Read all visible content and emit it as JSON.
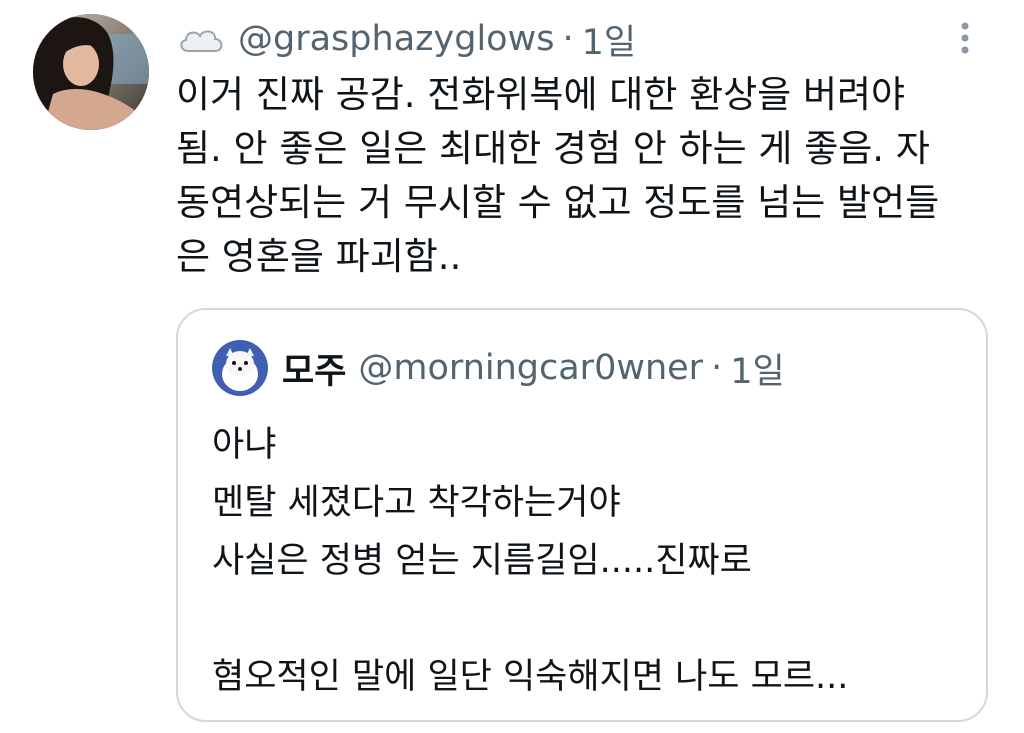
{
  "tweet": {
    "handle": "@grasphazyglows",
    "separator": "·",
    "time": "1일",
    "text": "이거 진짜 공감. 전화위복에 대한 환상을 버려야\n됨. 안 좋은 일은 최대한 경험 안 하는 게 좋음. 자\n동연상되는 거 무시할 수 없고 정도를 넘는 발언들\n은 영혼을 파괴함..",
    "avatar_icon": "user-avatar",
    "more_icon": "more-vertical-icon",
    "badge_icon": "cloud-icon"
  },
  "quote": {
    "name": "모주",
    "handle": "@morningcar0wner",
    "separator": "·",
    "time": "1일",
    "text": "아냐\n멘탈 세졌다고 착각하는거야\n사실은 정병 얻는 지름길임.....진짜로\n\n혐오적인 말에 일단 익숙해지면 나도 모르...",
    "avatar_icon": "dog-avatar"
  },
  "colors": {
    "text": "#0f1419",
    "secondary": "#536471",
    "border": "#cfd9de",
    "background": "#ffffff"
  }
}
